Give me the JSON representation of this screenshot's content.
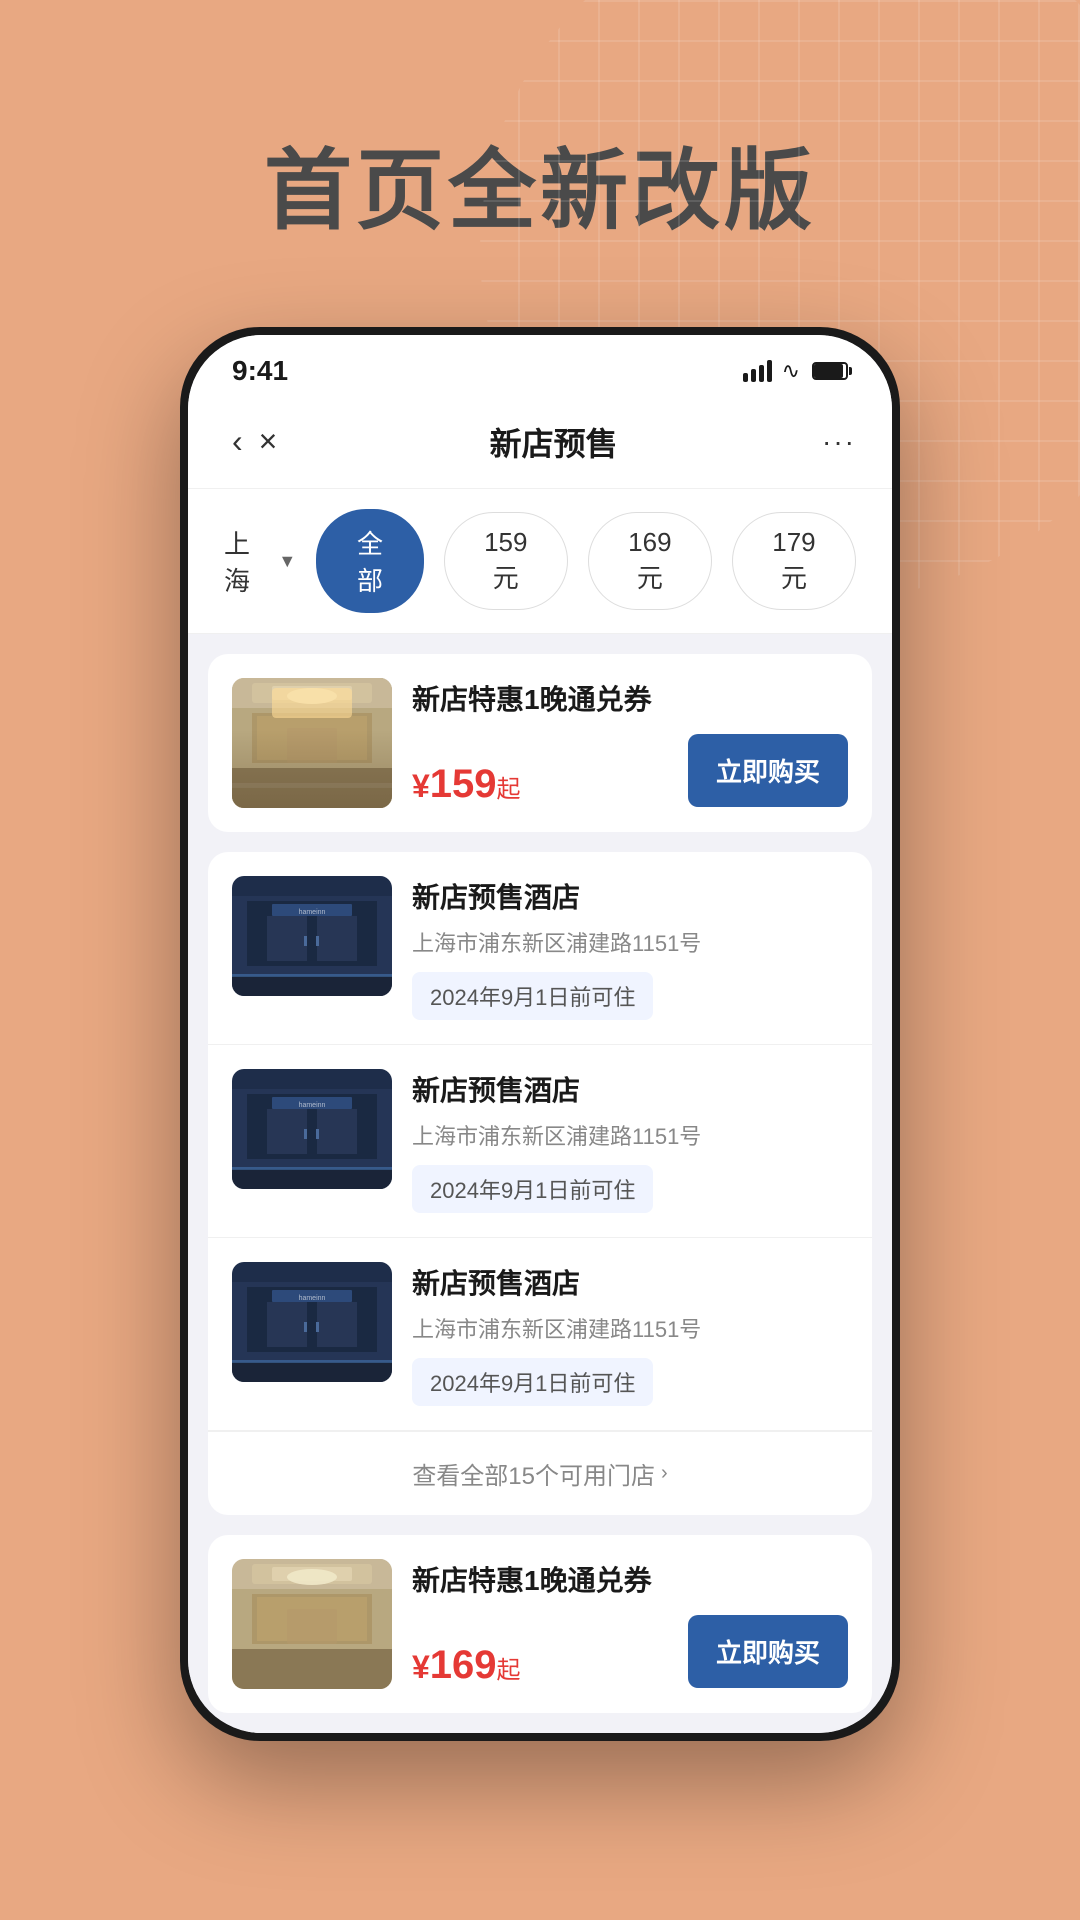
{
  "background": {
    "color": "#e8a882"
  },
  "page_title": "首页全新改版",
  "phone": {
    "status_bar": {
      "time": "9:41"
    },
    "nav": {
      "title": "新店预售",
      "more_label": "···"
    },
    "filter": {
      "location": "上海",
      "buttons": [
        {
          "label": "全部",
          "active": true
        },
        {
          "label": "159元",
          "active": false
        },
        {
          "label": "169元",
          "active": false
        },
        {
          "label": "179元",
          "active": false
        }
      ]
    },
    "cards": [
      {
        "type": "voucher",
        "name": "新店特惠1晚通兑券",
        "price_prefix": "¥",
        "price": "159",
        "price_suffix": "起",
        "buy_label": "立即购买"
      },
      {
        "type": "hotel_group",
        "hotels": [
          {
            "name": "新店预售酒店",
            "address": "上海市浦东新区浦建路1151号",
            "available": "2024年9月1日前可住"
          },
          {
            "name": "新店预售酒店",
            "address": "上海市浦东新区浦建路1151号",
            "available": "2024年9月1日前可住"
          },
          {
            "name": "新店预售酒店",
            "address": "上海市浦东新区浦建路1151号",
            "available": "2024年9月1日前可住"
          }
        ],
        "view_all": "查看全部15个可用门店"
      }
    ],
    "second_card": {
      "type": "voucher",
      "name": "新店特惠1晚通兑券",
      "price_prefix": "¥",
      "price": "169",
      "price_suffix": "起",
      "buy_label": "立即购买"
    }
  }
}
